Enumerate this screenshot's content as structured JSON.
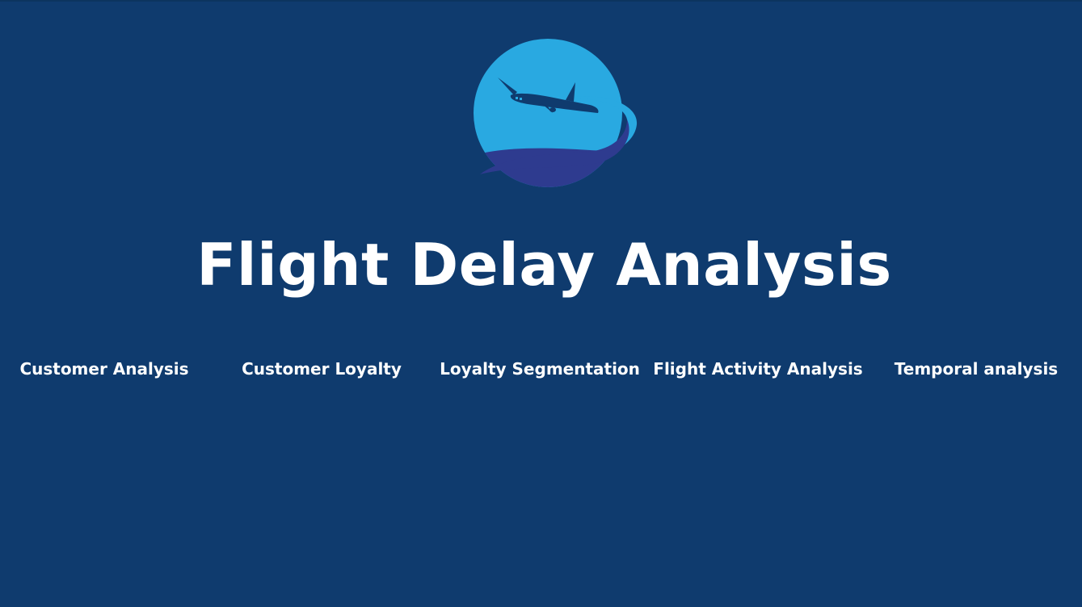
{
  "page": {
    "title": "Flight Delay Analysis",
    "background_color": "#0f3b6e"
  },
  "logo": {
    "icon": "airplane-logo",
    "circle_color": "#29a9e1",
    "wave_color": "#2e3b8f",
    "plane_color": "#0f3b6e"
  },
  "nav": {
    "items": [
      {
        "label": "Customer Analysis"
      },
      {
        "label": "Customer Loyalty"
      },
      {
        "label": "Loyalty Segmentation"
      },
      {
        "label": "Flight Activity Analysis"
      },
      {
        "label": "Temporal analysis"
      }
    ]
  }
}
